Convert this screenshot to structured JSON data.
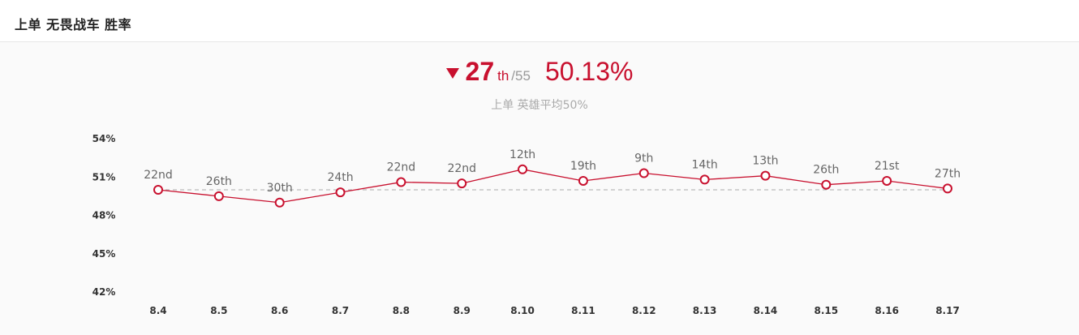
{
  "header": {
    "title": "上单 无畏战车 胜率"
  },
  "summary": {
    "trend": "down",
    "rank": "27",
    "rank_suffix": "th",
    "rank_total": "/55",
    "winrate": "50.13%",
    "subtitle": "上单 英雄平均50%"
  },
  "colors": {
    "accent": "#c8102e",
    "reference_line": "#aaaaaa"
  },
  "chart_data": {
    "type": "line",
    "categories": [
      "8.4",
      "8.5",
      "8.6",
      "8.7",
      "8.8",
      "8.9",
      "8.10",
      "8.11",
      "8.12",
      "8.13",
      "8.14",
      "8.15",
      "8.16",
      "8.17"
    ],
    "series": [
      {
        "values": [
          50.0,
          49.5,
          49.0,
          49.8,
          50.6,
          50.5,
          51.6,
          50.7,
          51.3,
          50.8,
          51.1,
          50.4,
          50.7,
          50.1
        ],
        "point_labels": [
          "22nd",
          "26th",
          "30th",
          "24th",
          "22nd",
          "22nd",
          "12th",
          "19th",
          "9th",
          "14th",
          "13th",
          "26th",
          "21st",
          "27th"
        ]
      }
    ],
    "ylim": [
      42,
      54
    ],
    "yticks": [
      54,
      51,
      48,
      45,
      42
    ],
    "ytick_labels": [
      "54%",
      "51%",
      "48%",
      "45%",
      "42%"
    ],
    "reference_value": 50,
    "grid": false
  }
}
